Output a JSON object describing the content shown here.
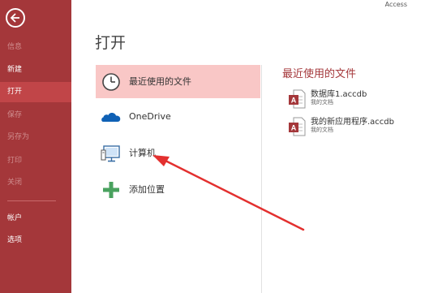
{
  "app_name": "Access",
  "sidebar": {
    "items": [
      {
        "label": "信息",
        "state": "disabled"
      },
      {
        "label": "新建",
        "state": "normal"
      },
      {
        "label": "打开",
        "state": "active"
      },
      {
        "label": "保存",
        "state": "disabled"
      },
      {
        "label": "另存为",
        "state": "disabled"
      },
      {
        "label": "打印",
        "state": "disabled"
      },
      {
        "label": "关闭",
        "state": "disabled"
      },
      {
        "label": "帐户",
        "state": "normal"
      },
      {
        "label": "选项",
        "state": "normal"
      }
    ]
  },
  "main": {
    "title": "打开",
    "places": [
      {
        "label": "最近使用的文件",
        "icon": "clock-icon",
        "selected": true
      },
      {
        "label": "OneDrive",
        "icon": "cloud-icon",
        "selected": false
      },
      {
        "label": "计算机",
        "icon": "computer-icon",
        "selected": false
      },
      {
        "label": "添加位置",
        "icon": "plus-icon",
        "selected": false
      }
    ],
    "recent": {
      "title": "最近使用的文件",
      "files": [
        {
          "name": "数据库1.accdb",
          "location": "我的文档"
        },
        {
          "name": "我的新应用程序.accdb",
          "location": "我的文档"
        }
      ]
    }
  },
  "colors": {
    "brand": "#a4373a",
    "sidebar_active": "#c14548",
    "place_selected": "#f9c7c6",
    "annotation_arrow": "#e3302f"
  }
}
